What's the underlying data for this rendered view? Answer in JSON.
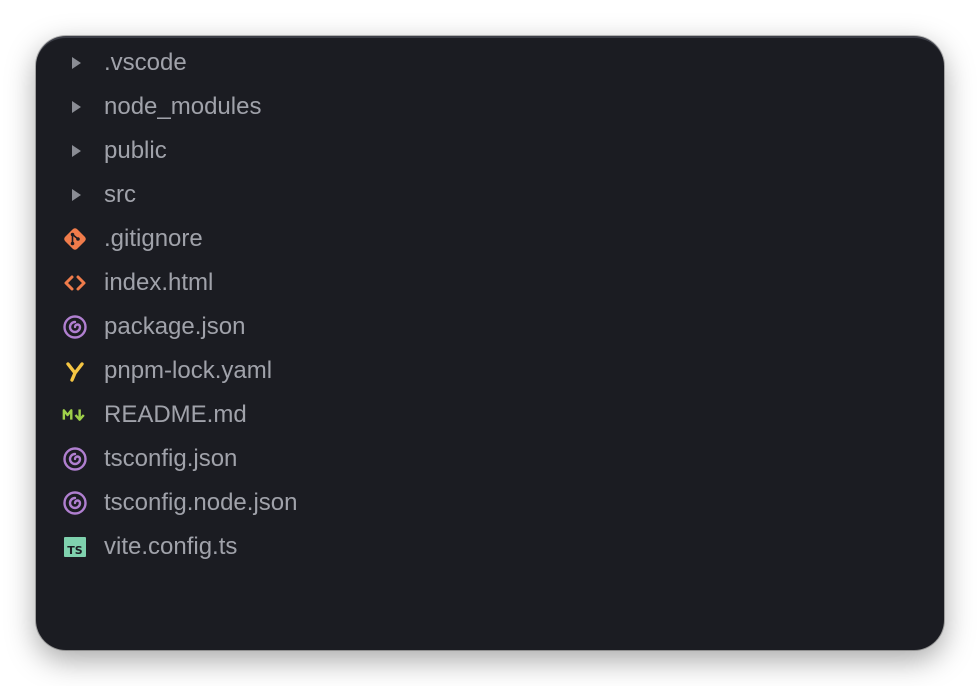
{
  "explorer": {
    "items": [
      {
        "label": ".vscode",
        "icon": "chevron-right-icon",
        "type": "folder"
      },
      {
        "label": "node_modules",
        "icon": "chevron-right-icon",
        "type": "folder"
      },
      {
        "label": "public",
        "icon": "chevron-right-icon",
        "type": "folder"
      },
      {
        "label": "src",
        "icon": "chevron-right-icon",
        "type": "folder"
      },
      {
        "label": ".gitignore",
        "icon": "git-icon",
        "type": "file"
      },
      {
        "label": "index.html",
        "icon": "html-icon",
        "type": "file"
      },
      {
        "label": "package.json",
        "icon": "json-spiral-icon",
        "type": "file"
      },
      {
        "label": "pnpm-lock.yaml",
        "icon": "yaml-icon",
        "type": "file"
      },
      {
        "label": "README.md",
        "icon": "markdown-icon",
        "type": "file"
      },
      {
        "label": "tsconfig.json",
        "icon": "json-spiral-icon",
        "type": "file"
      },
      {
        "label": "tsconfig.node.json",
        "icon": "json-spiral-icon",
        "type": "file"
      },
      {
        "label": "vite.config.ts",
        "icon": "typescript-icon",
        "type": "file"
      }
    ]
  },
  "colors": {
    "background": "#1b1c22",
    "text": "#a0a2aa",
    "caret": "#8a8c94",
    "git": "#f07c4b",
    "html": "#f07c4b",
    "json": "#b07fd0",
    "yaml": "#f5c543",
    "markdown": "#9fd04a",
    "typescript": "#7fd1ae"
  }
}
